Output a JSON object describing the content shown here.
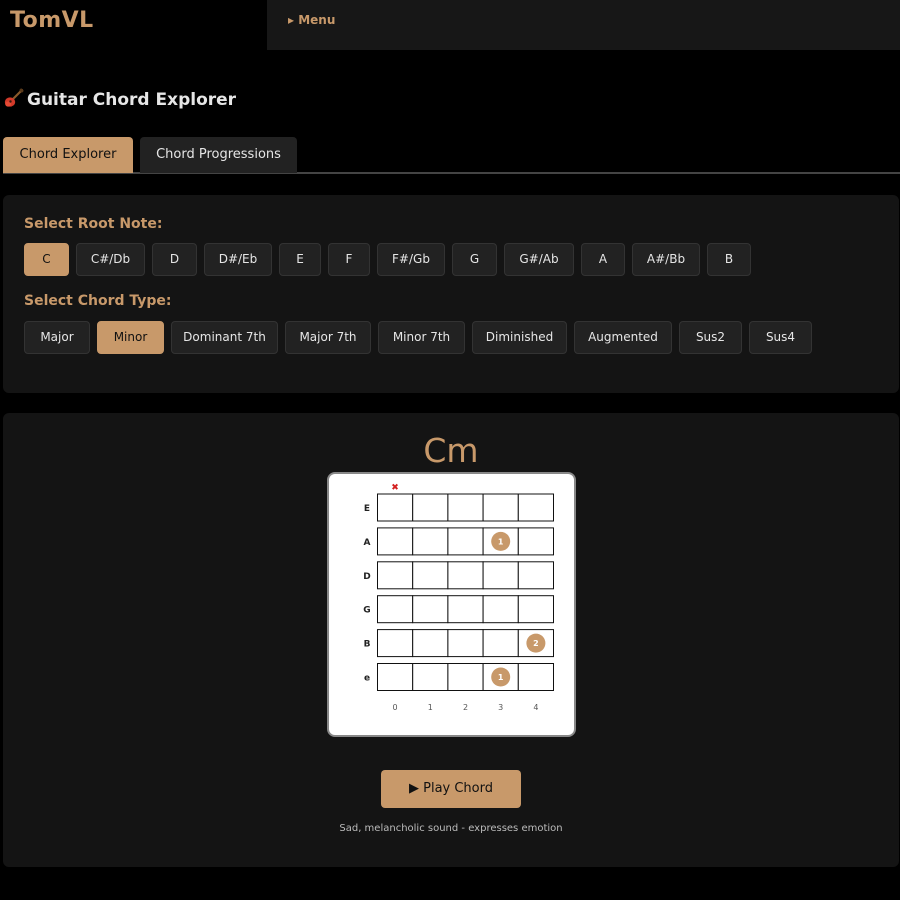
{
  "header": {
    "brand": "TomVL",
    "menu_label": "▸ Menu"
  },
  "page": {
    "title": "Guitar Chord Explorer"
  },
  "tabs": [
    {
      "label": "Chord Explorer",
      "active": true
    },
    {
      "label": "Chord Progressions",
      "active": false
    }
  ],
  "root_note": {
    "label": "Select Root Note:",
    "selected": "C",
    "options": [
      "C",
      "C#/Db",
      "D",
      "D#/Eb",
      "E",
      "F",
      "F#/Gb",
      "G",
      "G#/Ab",
      "A",
      "A#/Bb",
      "B"
    ]
  },
  "chord_type": {
    "label": "Select Chord Type:",
    "selected": "Minor",
    "options": [
      "Major",
      "Minor",
      "Dominant 7th",
      "Major 7th",
      "Minor 7th",
      "Diminished",
      "Augmented",
      "Sus2",
      "Sus4"
    ]
  },
  "chord": {
    "name": "Cm",
    "strings": [
      "E",
      "A",
      "D",
      "G",
      "B",
      "e"
    ],
    "fret_numbers": [
      "0",
      "1",
      "2",
      "3",
      "4"
    ],
    "muted_marker": "✖",
    "muted_strings": [
      "E"
    ],
    "fingers": [
      {
        "string": "A",
        "fret": 3,
        "finger": "1"
      },
      {
        "string": "B",
        "fret": 4,
        "finger": "2"
      },
      {
        "string": "e",
        "fret": 3,
        "finger": "1"
      }
    ],
    "play_label": "▶ Play Chord",
    "description": "Sad, melancholic sound - expresses emotion"
  },
  "colors": {
    "accent": "#c8996a",
    "muted_marker": "#d42020",
    "background": "#000000",
    "panel": "#141414"
  }
}
